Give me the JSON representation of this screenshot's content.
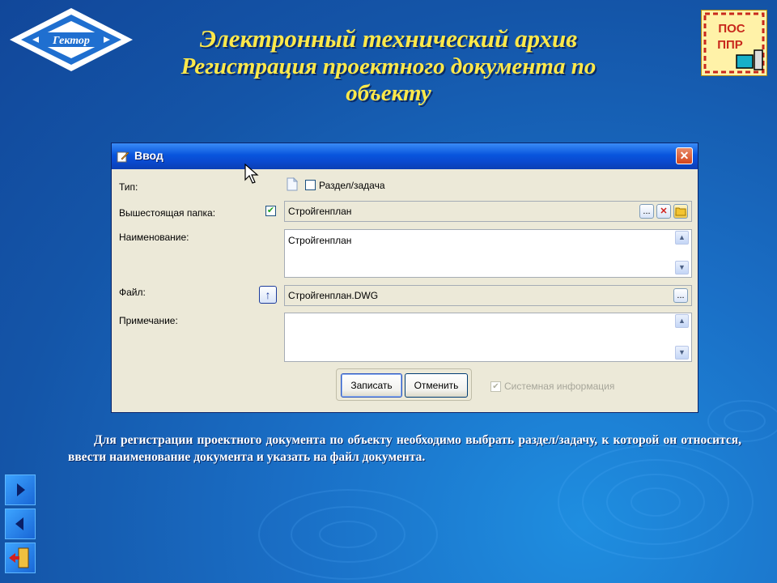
{
  "slide": {
    "title_line1": "Электронный технический архив",
    "title_line2": "Регистрация проектного документа по",
    "title_line3": "объекту",
    "description": "Для регистрации проектного документа по объекту необходимо выбрать раздел/задачу, к которой он относится, ввести наименование документа и указать на файл документа."
  },
  "logos": {
    "left_text": "Гектор",
    "right_line1": "ПОС",
    "right_line2": "ППР"
  },
  "dialog": {
    "title": "Ввод",
    "close_glyph": "✕",
    "type_label": "Тип:",
    "type_checkbox_label": "Раздел/задача",
    "parent_label": "Вышестоящая папка:",
    "parent_value": "Стройгенплан",
    "name_label": "Наименование:",
    "name_value": "Стройгенплан",
    "file_label": "Файл:",
    "file_value": "Стройгенплан.DWG",
    "note_label": "Примечание:",
    "note_value": "",
    "browse_glyph": "...",
    "clear_glyph": "✕",
    "upload_glyph": "↑",
    "save_button": "Записать",
    "cancel_button": "Отменить",
    "system_info_label": "Системная информация",
    "scroll_up": "▲",
    "scroll_down": "▼",
    "check_glyph": "✔"
  },
  "colors": {
    "title": "#ffe94a",
    "titlebar": "#0855dd",
    "dialog_bg": "#ece9d8",
    "background": "#1a6fc6"
  },
  "nav": {
    "next_icon": "play-right-icon",
    "prev_icon": "play-left-icon",
    "exit_icon": "exit-door-icon"
  }
}
